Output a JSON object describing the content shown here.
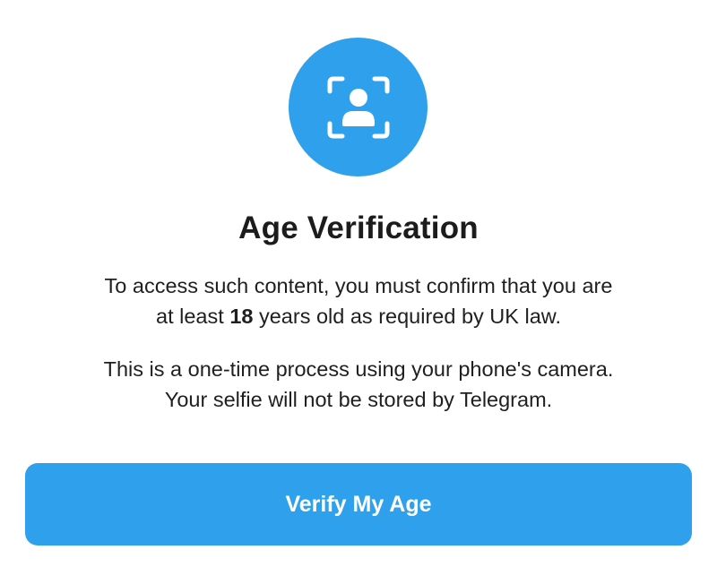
{
  "colors": {
    "accent": "#2fa1ec",
    "icon_foreground": "#ffffff",
    "button_text": "#ffffff"
  },
  "header_icon": {
    "name": "face-scan-icon"
  },
  "title": "Age Verification",
  "paragraph1": {
    "line1": "To access such content, you must confirm that you are",
    "line2_prefix": "at least ",
    "line2_bold": "18",
    "line2_suffix": " years old as required by UK law."
  },
  "paragraph2": {
    "line1": "This is a one-time process using your phone's camera.",
    "line2": "Your selfie will not be stored by Telegram."
  },
  "verify_button": {
    "label": "Verify My Age"
  }
}
